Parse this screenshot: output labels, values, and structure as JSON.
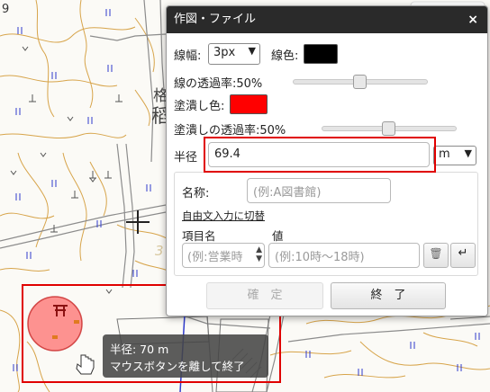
{
  "map": {
    "corner_number": "9",
    "kanji_1": "格",
    "kanji_2": "稻",
    "faded_char": "3",
    "shrine_symbol": "⛩"
  },
  "dialog": {
    "title": "作図・ファイル",
    "close_glyph": "×",
    "line_width_label": "線幅:",
    "line_width_value": "3px",
    "line_color_label": "線色:",
    "line_color": "#000000",
    "line_opacity_label": "線の透過率:50%",
    "line_opacity": 0.5,
    "fill_color_label": "塗潰し色:",
    "fill_color": "#ff0000",
    "fill_opacity_label": "塗潰しの透過率:50%",
    "fill_opacity": 0.5,
    "radius_label": "半径",
    "radius_value": "69.4",
    "radius_unit": "m",
    "name_label": "名称:",
    "name_placeholder": "(例:A図書館)",
    "free_text_link": "自由文入力に切替",
    "item_name_header": "項目名",
    "value_header": "値",
    "item_name_placeholder": "(例:営業時",
    "value_placeholder": "(例:10時〜18時)",
    "delete_icon": "🗑",
    "enter_icon": "↵",
    "confirm_button": "確　定",
    "finish_button": "終　了"
  },
  "tooltip": {
    "line1": "半径: 70 m",
    "line2": "マウスボタンを離して終了"
  },
  "colors": {
    "accent_red": "#e00000",
    "contour": "#d7a44a",
    "road": "#8c8c8c",
    "river_blue": "#2f3bcc"
  }
}
